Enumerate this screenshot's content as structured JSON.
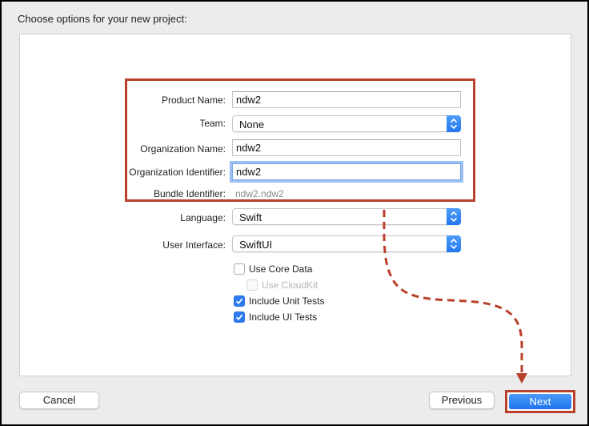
{
  "header": {
    "title": "Choose options for your new project:"
  },
  "form": {
    "product_name": {
      "label": "Product Name:",
      "value": "ndw2"
    },
    "team": {
      "label": "Team:",
      "value": "None"
    },
    "organization_name": {
      "label": "Organization Name:",
      "value": "ndw2"
    },
    "organization_identifier": {
      "label": "Organization Identifier:",
      "value": "ndw2"
    },
    "bundle_identifier": {
      "label": "Bundle Identifier:",
      "value": "ndw2.ndw2"
    },
    "language": {
      "label": "Language:",
      "value": "Swift"
    },
    "user_interface": {
      "label": "User Interface:",
      "value": "SwiftUI"
    }
  },
  "options": [
    {
      "label": "Use Core Data",
      "checked": false,
      "disabled": false
    },
    {
      "label": "Use CloudKit",
      "checked": false,
      "disabled": true
    },
    {
      "label": "Include Unit Tests",
      "checked": true,
      "disabled": false
    },
    {
      "label": "Include UI Tests",
      "checked": true,
      "disabled": false
    }
  ],
  "buttons": {
    "cancel": "Cancel",
    "previous": "Previous",
    "next": "Next"
  },
  "colors": {
    "accent": "#2d7bf2",
    "annotation": "#b9402b"
  }
}
